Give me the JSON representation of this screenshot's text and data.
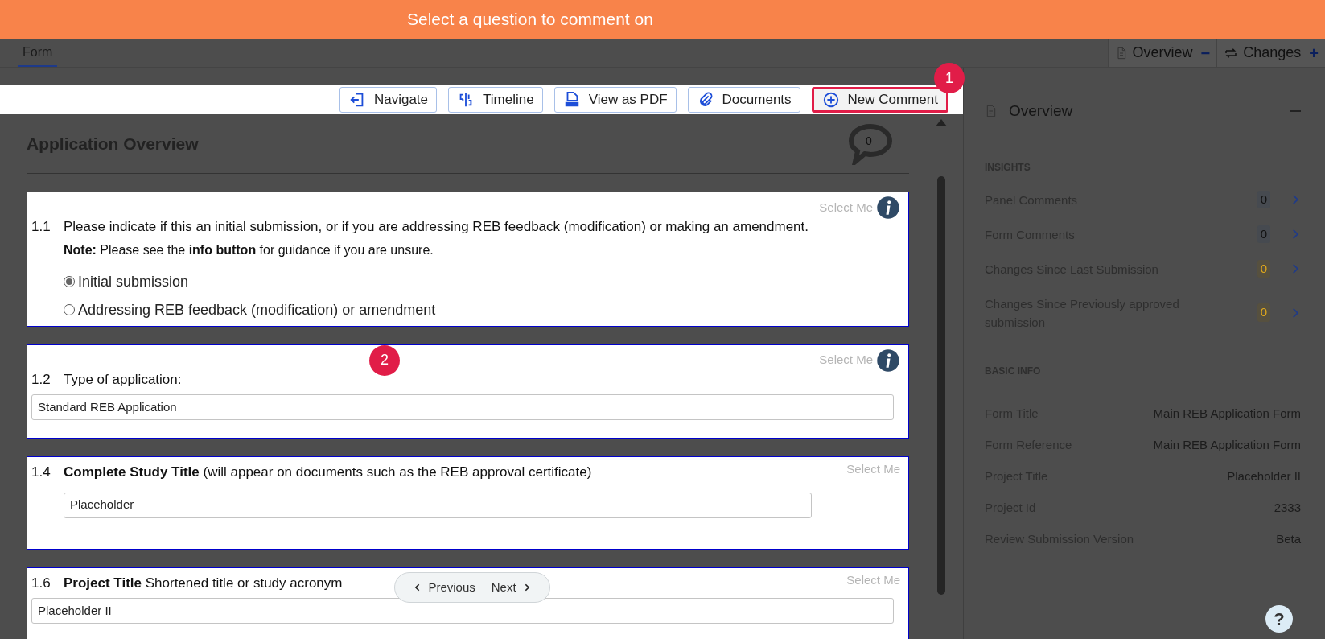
{
  "banner": {
    "text": "Select a question to comment on"
  },
  "tabs": [
    {
      "label": "Form",
      "selected": true
    }
  ],
  "panel_toggles": [
    {
      "label": "Overview",
      "sign": "−",
      "kind": "overview"
    },
    {
      "label": "Changes",
      "sign": "+",
      "kind": "changes"
    }
  ],
  "toolbar": [
    {
      "label": "Navigate",
      "kind": "navigate",
      "highlighted": false
    },
    {
      "label": "Timeline",
      "kind": "timeline",
      "highlighted": false
    },
    {
      "label": "View as PDF",
      "kind": "pdf",
      "highlighted": false
    },
    {
      "label": "Documents",
      "kind": "documents",
      "highlighted": false
    },
    {
      "label": "New Comment",
      "kind": "comment",
      "highlighted": true,
      "step": "1"
    }
  ],
  "section": {
    "title": "Application Overview",
    "comment_count": "0"
  },
  "questions": [
    {
      "number": "1.1",
      "kind": "radio",
      "prompt": "Please indicate if this an initial submission, or if you are addressing REB feedback (modification) or making an amendment.",
      "note": "**Note:** Please see the **info button** for guidance if you are unsure.",
      "hint": "Select Me",
      "info": true,
      "options": [
        {
          "label": "Initial submission",
          "selected": true
        },
        {
          "label": "Addressing REB feedback (modification) or amendment",
          "selected": false
        }
      ]
    },
    {
      "number": "1.2",
      "kind": "text",
      "prompt": "Type of application:",
      "hint": "Select Me",
      "info": true,
      "value": "Standard REB Application",
      "step": "2"
    },
    {
      "number": "1.4",
      "kind": "text_indented",
      "prompt": "**Complete Study Title** (will appear on documents such as the REB approval certificate)",
      "hint": "Select Me",
      "info": false,
      "value": "Placeholder"
    },
    {
      "number": "1.6",
      "kind": "text",
      "prompt": "**Project Title** Shortened title or study acronym",
      "hint": "Select Me",
      "info": false,
      "value": "Placeholder II"
    }
  ],
  "pager": {
    "previous": "Previous",
    "next": "Next"
  },
  "sidebar": {
    "title": "Overview",
    "insights_heading": "INSIGHTS",
    "insights": [
      {
        "label": "Panel Comments",
        "count": "0",
        "warning": false
      },
      {
        "label": "Form Comments",
        "count": "0",
        "warning": false
      },
      {
        "label": "Changes Since Last Submission",
        "count": "0",
        "warning": true
      },
      {
        "label": "Changes Since Previously approved submission",
        "count": "0",
        "warning": true
      }
    ],
    "basic_heading": "BASIC INFO",
    "basic_info": [
      {
        "label": "Form Title",
        "value": "Main REB Application Form"
      },
      {
        "label": "Form Reference",
        "value": "Main REB Application Form"
      },
      {
        "label": "Project Title",
        "value": "Placeholder II"
      },
      {
        "label": "Project Id",
        "value": "2333"
      },
      {
        "label": "Review Submission Version",
        "value": "Beta"
      }
    ]
  },
  "help": {
    "text": "?"
  }
}
